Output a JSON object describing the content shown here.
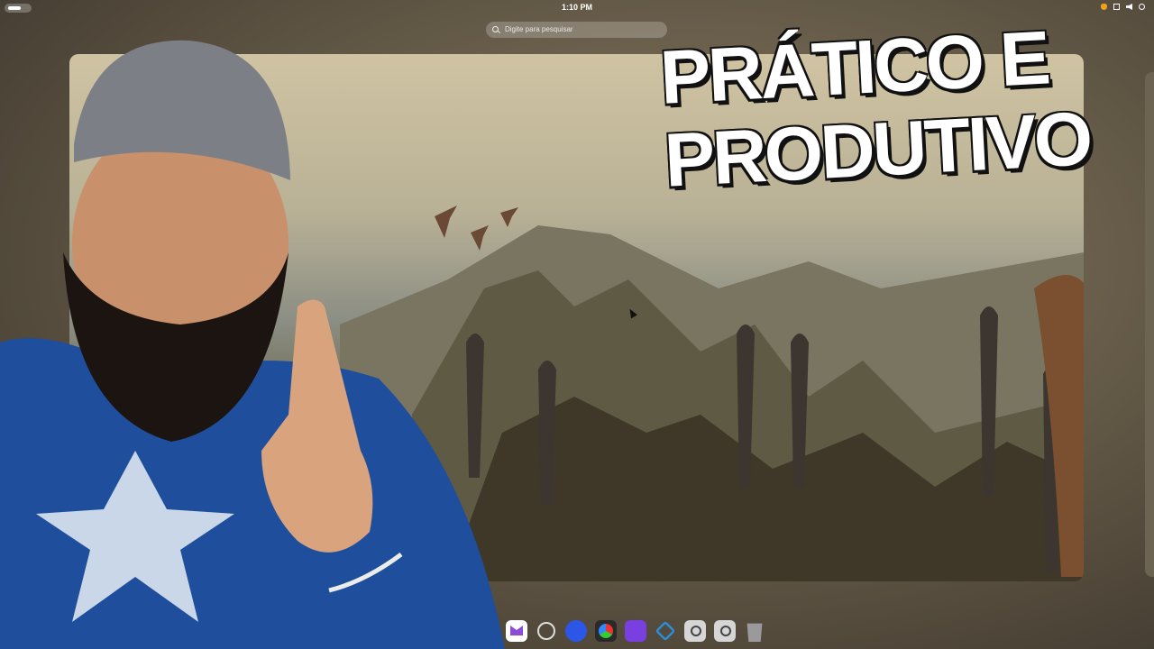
{
  "topbar": {
    "clock": "1:10 PM",
    "tray_icons": [
      "microphone-icon",
      "screen-icon",
      "volume-icon",
      "power-icon"
    ]
  },
  "search": {
    "placeholder": "Digite para pesquisar"
  },
  "headline": {
    "line1": "PRÁTICO E",
    "line2": "PRODUTIVO"
  },
  "dock": {
    "apps": [
      "mail-app-icon",
      "obs-icon",
      "headphones-icon",
      "davinci-resolve-icon",
      "app-purple-icon",
      "vscode-icon",
      "app-gray-icon",
      "app-gray-2-icon",
      "trash-icon"
    ]
  },
  "colors": {
    "accent": "#8d4cd8",
    "wallpaper_sky": "#cfc3a2",
    "headline": "#ffffff"
  }
}
